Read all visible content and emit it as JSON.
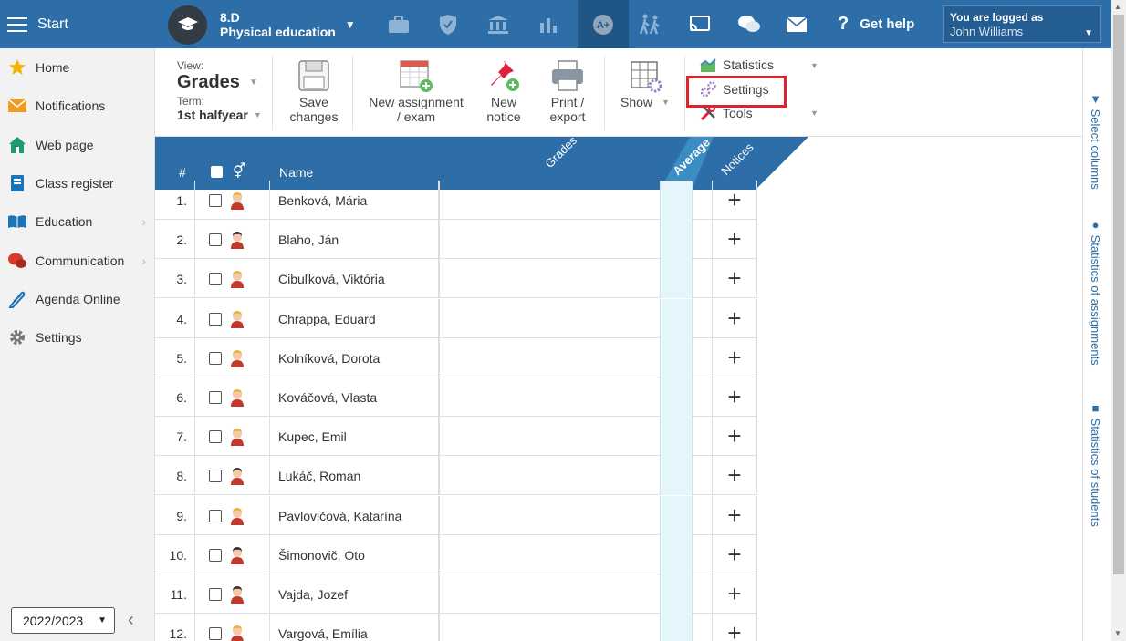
{
  "header": {
    "start_label": "Start",
    "class_code": "8.D",
    "subject": "Physical education",
    "get_help": "Get help",
    "logged_as_label": "You are logged as",
    "user_name": "John Williams"
  },
  "sidebar": {
    "items": [
      {
        "label": "Home",
        "icon": "star-icon"
      },
      {
        "label": "Notifications",
        "icon": "envelope-icon"
      },
      {
        "label": "Web page",
        "icon": "house-icon"
      },
      {
        "label": "Class register",
        "icon": "book-icon"
      },
      {
        "label": "Education",
        "icon": "open-book-icon"
      },
      {
        "label": "Communication",
        "icon": "chat-icon"
      },
      {
        "label": "Agenda Online",
        "icon": "pen-icon"
      },
      {
        "label": "Settings",
        "icon": "gear-icon"
      }
    ],
    "school_year": "2022/2023"
  },
  "toolbar": {
    "view_label": "View:",
    "view_value": "Grades",
    "term_label": "Term:",
    "term_value": "1st halfyear",
    "save_line1": "Save",
    "save_line2": "changes",
    "new_assign_line1": "New assignment",
    "new_assign_line2": "/ exam",
    "new_notice_line1": "New",
    "new_notice_line2": "notice",
    "print_line1": "Print /",
    "print_line2": "export",
    "show_label": "Show",
    "statistics_label": "Statistics",
    "settings_label": "Settings",
    "tools_label": "Tools"
  },
  "right_panel": {
    "select_columns": "Select columns",
    "stats_assignments": "Statistics of assignments",
    "stats_students": "Statistics of students"
  },
  "grid": {
    "col_num": "#",
    "col_name": "Name",
    "col_grades": "Grades",
    "col_average": "Average",
    "col_notices": "Notices",
    "rows": [
      {
        "num": "1.",
        "name": "Benková, Mária",
        "gender": "f"
      },
      {
        "num": "2.",
        "name": "Blaho, Ján",
        "gender": "m"
      },
      {
        "num": "3.",
        "name": "Cibuľková, Viktória",
        "gender": "f"
      },
      {
        "num": "4.",
        "name": "Chrappa, Eduard",
        "gender": "f"
      },
      {
        "num": "5.",
        "name": "Kolníková, Dorota",
        "gender": "f"
      },
      {
        "num": "6.",
        "name": "Kováčová, Vlasta",
        "gender": "f"
      },
      {
        "num": "7.",
        "name": "Kupec, Emil",
        "gender": "f"
      },
      {
        "num": "8.",
        "name": "Lukáč, Roman",
        "gender": "m"
      },
      {
        "num": "9.",
        "name": "Pavlovičová, Katarína",
        "gender": "f"
      },
      {
        "num": "10.",
        "name": "Šimonovič, Oto",
        "gender": "m"
      },
      {
        "num": "11.",
        "name": "Vajda, Jozef",
        "gender": "m"
      },
      {
        "num": "12.",
        "name": "Vargová, Emília",
        "gender": "f"
      }
    ]
  },
  "colors": {
    "header_blue": "#2d6ea8",
    "header_active": "#1f5685",
    "highlight_red": "#e0202a",
    "average_bg": "#e4f5fc"
  }
}
